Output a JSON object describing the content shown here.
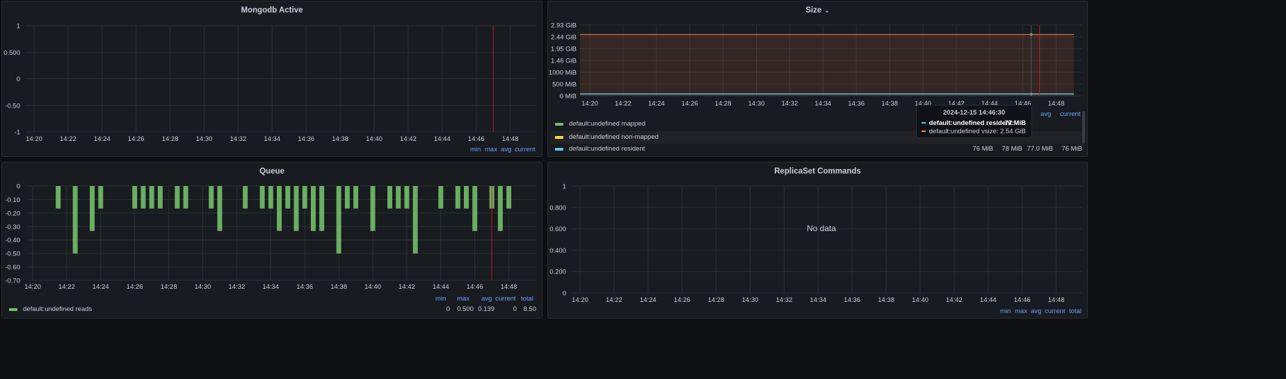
{
  "panels": {
    "mongodb_active": {
      "title": "Mongodb Active",
      "legend_headers": [
        "min",
        "max",
        "avg",
        "current"
      ]
    },
    "size": {
      "title": "Size",
      "legend_headers": [
        "avg",
        "current"
      ],
      "legend": [
        {
          "name": "default:undefined mapped",
          "color": "#73bf69"
        },
        {
          "name": "default:undefined non-mapped",
          "color": "#fade2a"
        },
        {
          "name": "default:undefined resident",
          "color": "#5ec8e0",
          "min": "76 MiB",
          "max": "78 MiB",
          "avg": "77.0 MiB",
          "current": "76 MiB"
        }
      ],
      "tooltip": {
        "time": "2024-12-15 14:46:30",
        "rows": [
          {
            "label": "default:undefined resident:",
            "value": "77 MiB",
            "color": "#5ec8e0"
          },
          {
            "label": "default:undefined vsize:",
            "value": "2.54 GiB",
            "color": "#ff7f3f"
          }
        ]
      }
    },
    "queue": {
      "title": "Queue",
      "legend_headers": [
        "min",
        "max",
        "avg",
        "current",
        "total"
      ],
      "legend": [
        {
          "name": "default:undefined reads",
          "color": "#73bf69",
          "min": "0",
          "max": "0.500",
          "avg": "0.139",
          "current": "0",
          "total": "8.50"
        }
      ]
    },
    "replicaset": {
      "title": "ReplicaSet Commands",
      "no_data": "No data",
      "legend_headers": [
        "min",
        "max",
        "avg",
        "current",
        "total"
      ]
    }
  },
  "chart_data": [
    {
      "id": "mongodb_active",
      "type": "line",
      "x": [
        "14:20",
        "14:22",
        "14:24",
        "14:26",
        "14:28",
        "14:30",
        "14:32",
        "14:34",
        "14:36",
        "14:38",
        "14:40",
        "14:42",
        "14:44",
        "14:46",
        "14:48"
      ],
      "ylim": [
        -1,
        1
      ],
      "y_ticks": [
        "1",
        "0.500",
        "0",
        "-0.50",
        "-1"
      ],
      "series": [],
      "marker_time": "14:47"
    },
    {
      "id": "size",
      "type": "area",
      "x": [
        "14:20",
        "14:22",
        "14:24",
        "14:26",
        "14:28",
        "14:30",
        "14:32",
        "14:34",
        "14:36",
        "14:38",
        "14:40",
        "14:42",
        "14:44",
        "14:46",
        "14:48"
      ],
      "y_ticks": [
        "2.93 GiB",
        "2.44 GiB",
        "1.95 GiB",
        "1.46 GiB",
        "1000 MiB",
        "500 MiB",
        "0 MiB"
      ],
      "y_values_mib": [
        3000,
        2500,
        2000,
        1500,
        1000,
        500,
        0
      ],
      "series": [
        {
          "name": "default:undefined vsize",
          "color": "#ff7f3f",
          "value_mib": 2600
        },
        {
          "name": "default:undefined resident",
          "color": "#5ec8e0",
          "value_mib": 77
        }
      ],
      "marker_time": "14:47"
    },
    {
      "id": "queue",
      "type": "bar",
      "x_ticks": [
        "14:20",
        "14:22",
        "14:24",
        "14:26",
        "14:28",
        "14:30",
        "14:32",
        "14:34",
        "14:36",
        "14:38",
        "14:40",
        "14:42",
        "14:44",
        "14:46",
        "14:48"
      ],
      "y_ticks": [
        "0",
        "-0.10",
        "-0.20",
        "-0.30",
        "-0.40",
        "-0.50",
        "-0.60",
        "-0.70"
      ],
      "ylim": [
        -0.7,
        0
      ],
      "series": [
        {
          "name": "default:undefined reads",
          "color": "#73bf69"
        }
      ],
      "bars": [
        {
          "t": "14:21:30",
          "v": -0.167
        },
        {
          "t": "14:22:30",
          "v": -0.5
        },
        {
          "t": "14:23:30",
          "v": -0.333
        },
        {
          "t": "14:24",
          "v": -0.167
        },
        {
          "t": "14:26",
          "v": -0.167
        },
        {
          "t": "14:26:30",
          "v": -0.167
        },
        {
          "t": "14:27",
          "v": -0.167
        },
        {
          "t": "14:27:30",
          "v": -0.167
        },
        {
          "t": "14:28:30",
          "v": -0.167
        },
        {
          "t": "14:29",
          "v": -0.167
        },
        {
          "t": "14:30:30",
          "v": -0.167
        },
        {
          "t": "14:31",
          "v": -0.333
        },
        {
          "t": "14:32:30",
          "v": -0.167
        },
        {
          "t": "14:33:30",
          "v": -0.167
        },
        {
          "t": "14:34",
          "v": -0.167
        },
        {
          "t": "14:34:30",
          "v": -0.333
        },
        {
          "t": "14:35",
          "v": -0.167
        },
        {
          "t": "14:35:30",
          "v": -0.333
        },
        {
          "t": "14:36",
          "v": -0.167
        },
        {
          "t": "14:36:30",
          "v": -0.333
        },
        {
          "t": "14:37",
          "v": -0.333
        },
        {
          "t": "14:38",
          "v": -0.5
        },
        {
          "t": "14:38:30",
          "v": -0.167
        },
        {
          "t": "14:39",
          "v": -0.167
        },
        {
          "t": "14:40",
          "v": -0.333
        },
        {
          "t": "14:41",
          "v": -0.167
        },
        {
          "t": "14:41:30",
          "v": -0.167
        },
        {
          "t": "14:42",
          "v": -0.167
        },
        {
          "t": "14:42:30",
          "v": -0.5
        },
        {
          "t": "14:44",
          "v": -0.167
        },
        {
          "t": "14:45",
          "v": -0.167
        },
        {
          "t": "14:45:30",
          "v": -0.167
        },
        {
          "t": "14:46",
          "v": -0.333
        },
        {
          "t": "14:47",
          "v": -0.167
        },
        {
          "t": "14:47:30",
          "v": -0.333
        },
        {
          "t": "14:48",
          "v": -0.167
        }
      ],
      "marker_time": "14:47"
    },
    {
      "id": "replicaset",
      "type": "line",
      "x": [
        "14:20",
        "14:22",
        "14:24",
        "14:26",
        "14:28",
        "14:30",
        "14:32",
        "14:34",
        "14:36",
        "14:38",
        "14:40",
        "14:42",
        "14:44",
        "14:46",
        "14:48"
      ],
      "y_ticks": [
        "1",
        "0.800",
        "0.600",
        "0.400",
        "0.200",
        "0"
      ],
      "ylim": [
        0,
        1
      ],
      "series": []
    }
  ]
}
